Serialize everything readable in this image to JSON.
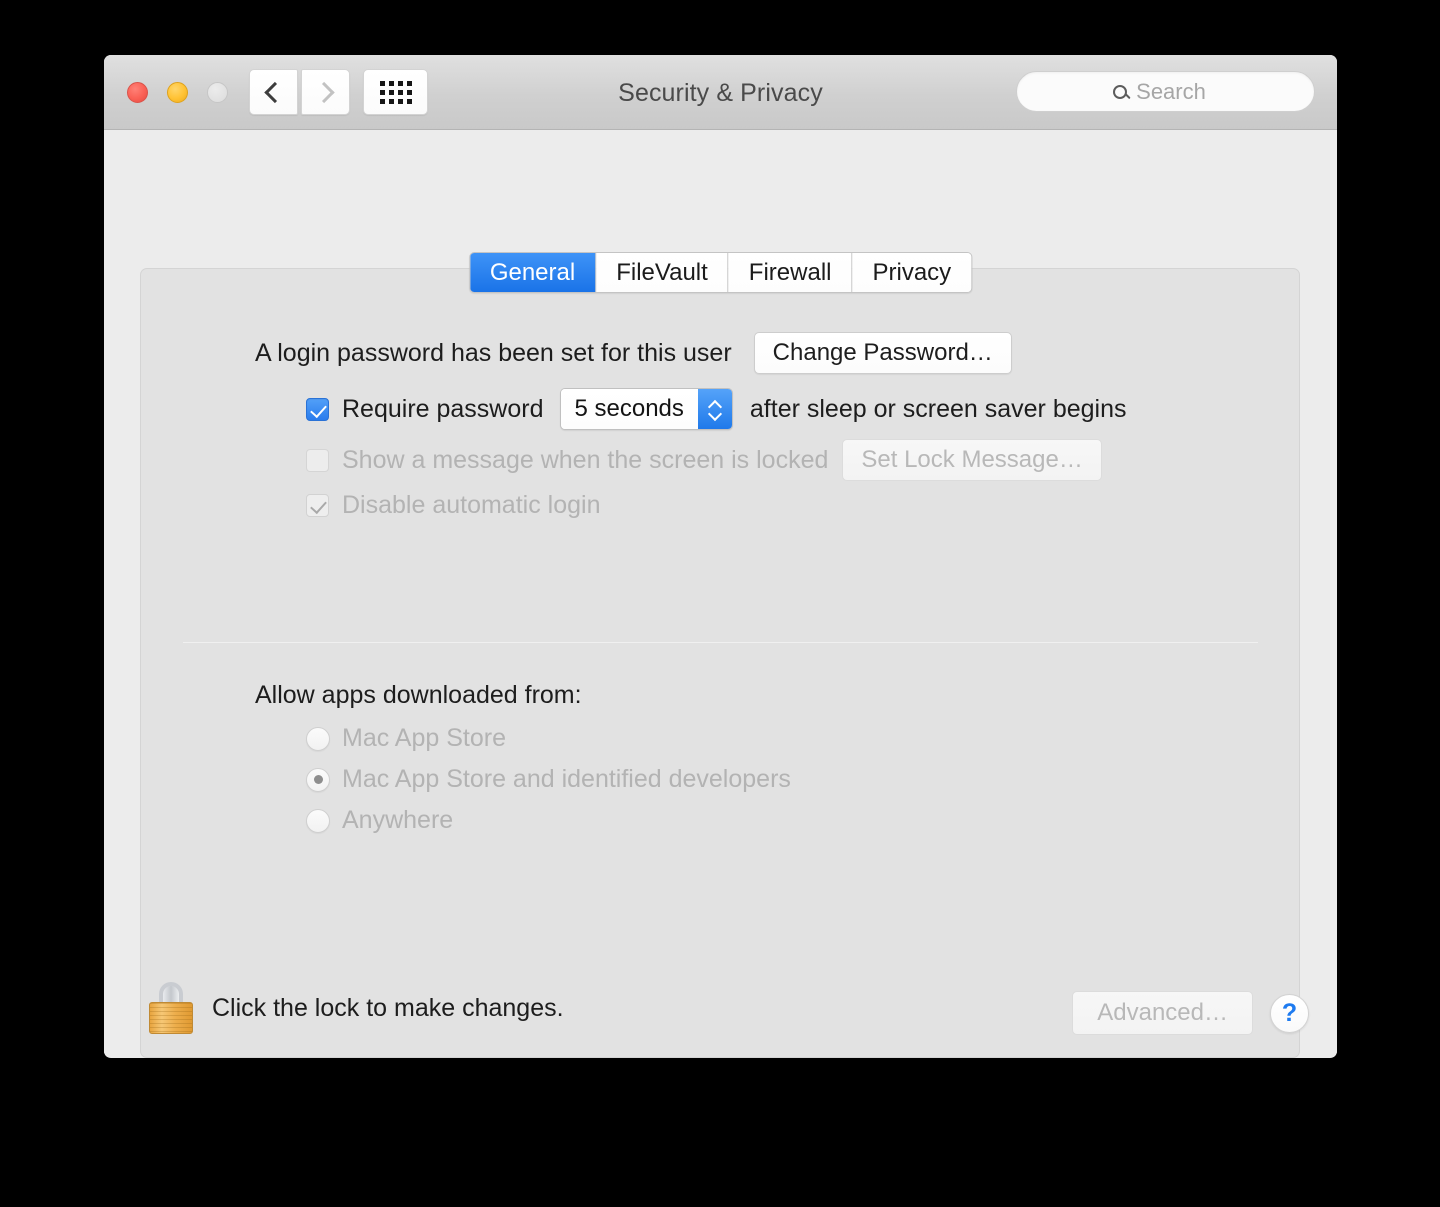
{
  "window": {
    "title": "Security & Privacy",
    "traffic_lights": [
      "close",
      "minimize",
      "zoom"
    ],
    "nav": {
      "back_icon": "chevron-left-icon",
      "forward_icon": "chevron-right-icon",
      "show_all_icon": "grid-icon"
    },
    "search": {
      "placeholder": "Search",
      "icon": "search-icon",
      "value": ""
    }
  },
  "tabs": [
    {
      "label": "General",
      "active": true
    },
    {
      "label": "FileVault",
      "active": false
    },
    {
      "label": "Firewall",
      "active": false
    },
    {
      "label": "Privacy",
      "active": false
    }
  ],
  "general": {
    "password_status": "A login password has been set for this user",
    "change_password_button": "Change Password…",
    "require_password": {
      "label": "Require password",
      "checked": true,
      "delay_value": "5 seconds",
      "suffix": "after sleep or screen saver begins"
    },
    "lock_message": {
      "label": "Show a message when the screen is locked",
      "checked": false,
      "button": "Set Lock Message…",
      "disabled": true
    },
    "disable_auto_login": {
      "label": "Disable automatic login",
      "checked": true,
      "disabled": true
    },
    "allow_apps": {
      "heading": "Allow apps downloaded from:",
      "options": [
        {
          "label": "Mac App Store",
          "selected": false
        },
        {
          "label": "Mac App Store and identified developers",
          "selected": true
        },
        {
          "label": "Anywhere",
          "selected": false
        }
      ]
    }
  },
  "footer": {
    "lock_icon": "padlock-closed-icon",
    "lock_text": "Click the lock to make changes.",
    "advanced_button": "Advanced…",
    "help_button": "?"
  },
  "colors": {
    "accent_blue": "#1a73e8",
    "window_bg": "#ececec",
    "panel_bg": "#e2e2e2",
    "disabled_text": "#b3b3b3",
    "lock_gold": "#edae4c"
  }
}
